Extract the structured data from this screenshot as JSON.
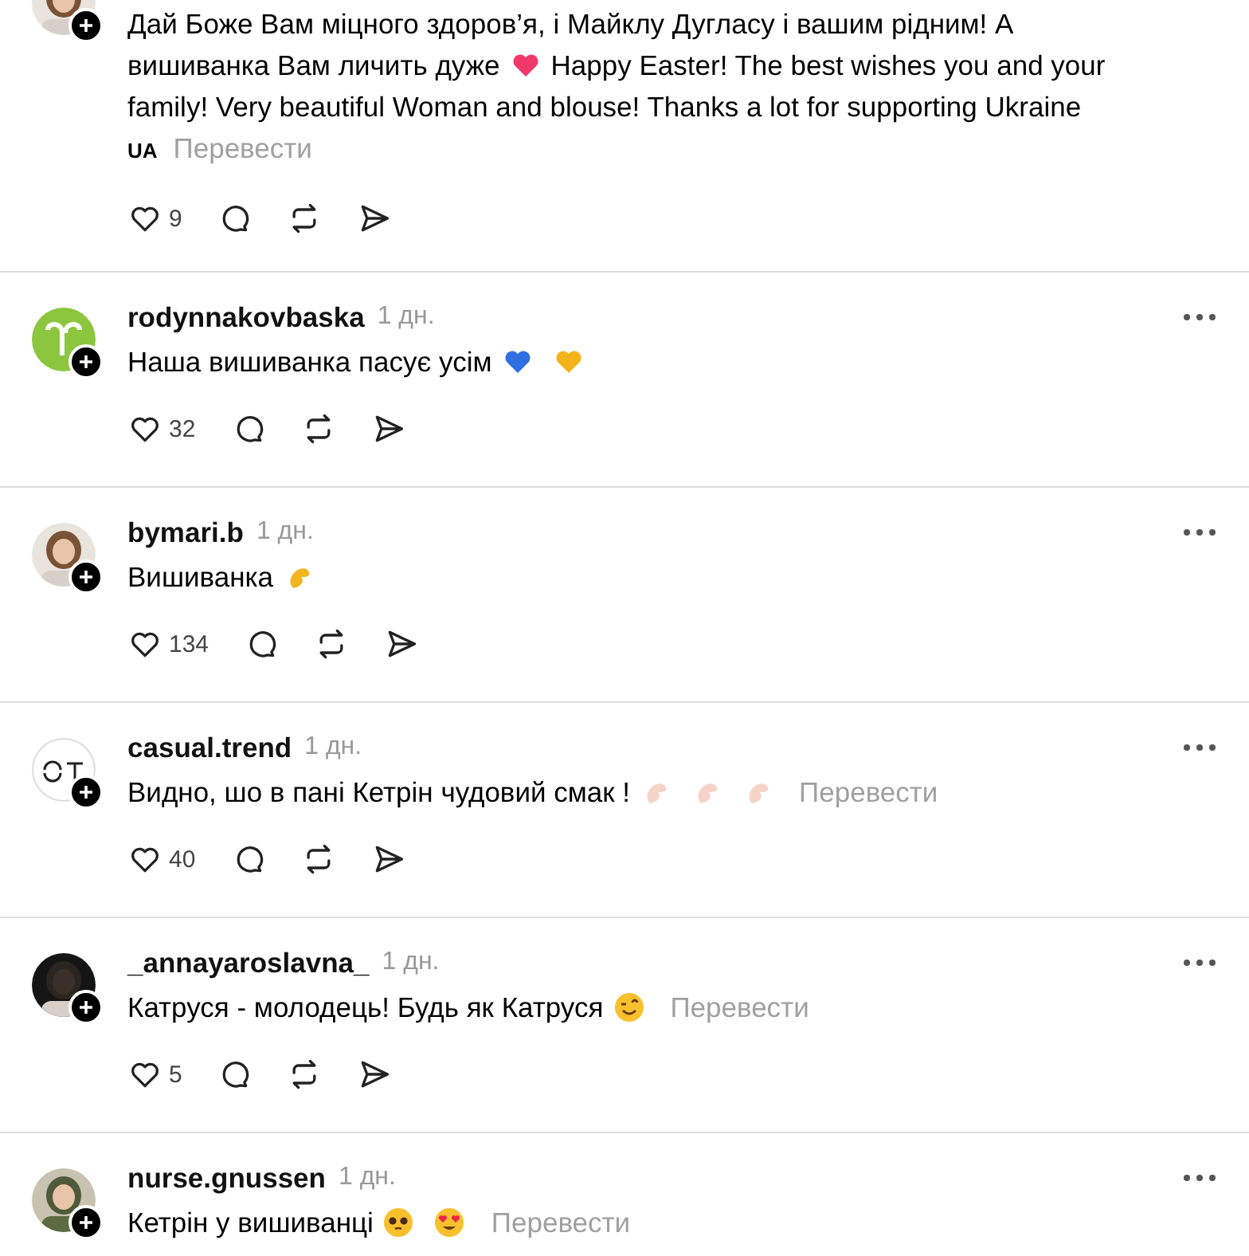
{
  "comments": [
    {
      "parts": [
        {
          "kind": "text",
          "text": "Дай Боже Вам міцного здоров’я, і Майклу Дугласу і вашим рідним! А"
        },
        {
          "kind": "break"
        },
        {
          "kind": "text",
          "text": "вишиванка Вам личить дуже"
        },
        {
          "kind": "heart",
          "color": "#f0386b"
        },
        {
          "kind": "text",
          "text": "Happy Easter! The best wishes you and your"
        },
        {
          "kind": "break"
        },
        {
          "kind": "text",
          "text": "family! Very beautiful Woman and blouse! Thanks a lot for supporting Ukraine"
        },
        {
          "kind": "break"
        },
        {
          "kind": "flag",
          "text": "UA"
        }
      ],
      "translate": "Перевести",
      "likes": "9"
    },
    {
      "avatar": {
        "kind": "logo-green"
      },
      "user": "rodynnakovbaska",
      "time": "1 дн.",
      "parts": [
        {
          "kind": "text",
          "text": "Наша вишиванка пасує усім"
        },
        {
          "kind": "heart",
          "color": "#2f6fe0"
        },
        {
          "kind": "heart",
          "color": "#f5b31b"
        }
      ],
      "likes": "32"
    },
    {
      "avatar": {
        "kind": "photo-light"
      },
      "user": "bymari.b",
      "time": "1 дн.",
      "parts": [
        {
          "kind": "text",
          "text": "Вишиванка"
        },
        {
          "kind": "pinch",
          "color": "#f2b51e"
        }
      ],
      "likes": "134"
    },
    {
      "avatar": {
        "kind": "logo-outline"
      },
      "user": "casual.trend",
      "time": "1 дн.",
      "parts": [
        {
          "kind": "text",
          "text": "Видно, шо в пані Кетрін чудовий смак !"
        },
        {
          "kind": "pinch",
          "color": "#f6d3c8"
        },
        {
          "kind": "pinch",
          "color": "#f6d3c8"
        },
        {
          "kind": "pinch",
          "color": "#f6d3c8"
        }
      ],
      "translate": "Перевести",
      "likes": "40"
    },
    {
      "avatar": {
        "kind": "photo-dark"
      },
      "user": "_annayaroslavna_",
      "time": "1 дн.",
      "parts": [
        {
          "kind": "text",
          "text": "Катруся - молодець! Будь як Катруся"
        },
        {
          "kind": "wink"
        }
      ],
      "translate": "Перевести",
      "likes": "5"
    },
    {
      "avatar": {
        "kind": "photo-hat"
      },
      "user": "nurse.gnussen",
      "time": "1 дн.",
      "parts": [
        {
          "kind": "text",
          "text": "Кетрін у вишиванці"
        },
        {
          "kind": "pleading"
        },
        {
          "kind": "heart-eyes"
        }
      ],
      "translate": "Перевести"
    }
  ]
}
